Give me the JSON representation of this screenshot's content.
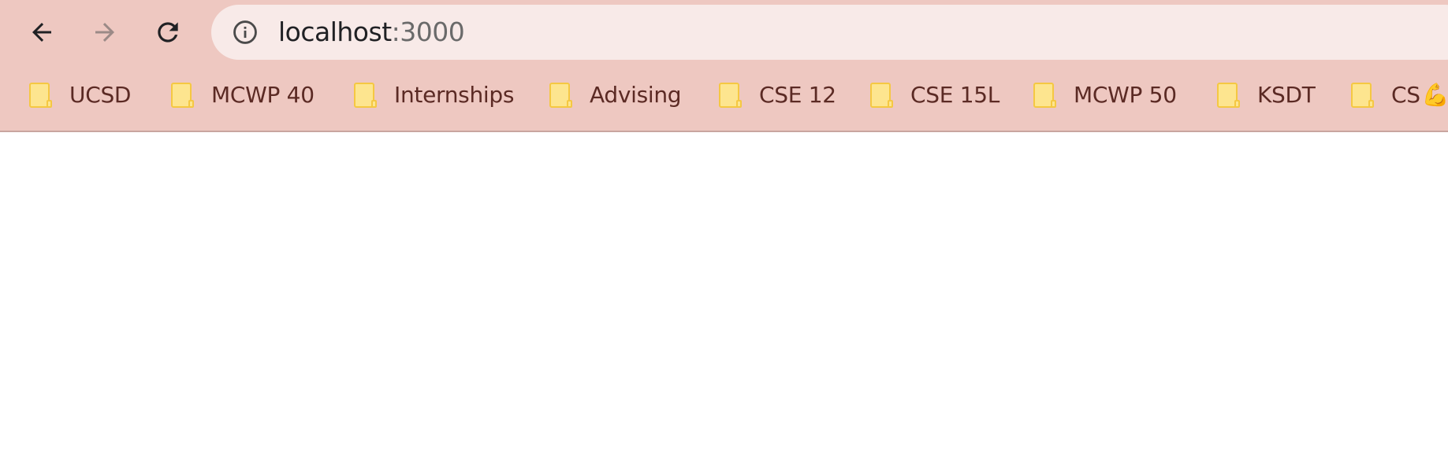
{
  "toolbar": {
    "back_icon": "arrow-left-icon",
    "forward_icon": "arrow-right-icon",
    "reload_icon": "reload-icon"
  },
  "omnibox": {
    "info_icon": "info-icon",
    "host": "localhost",
    "port": ":3000"
  },
  "bookmarks": [
    {
      "label": "UCSD",
      "icon": "folder-icon"
    },
    {
      "label": "MCWP 40",
      "icon": "folder-icon"
    },
    {
      "label": "Internships",
      "icon": "folder-icon"
    },
    {
      "label": "Advising",
      "icon": "folder-icon"
    },
    {
      "label": "CSE 12",
      "icon": "folder-icon"
    },
    {
      "label": "CSE 15L",
      "icon": "folder-icon"
    },
    {
      "label": "MCWP 50",
      "icon": "folder-icon"
    },
    {
      "label": "KSDT",
      "icon": "folder-icon"
    },
    {
      "label": "CS",
      "icon": "folder-icon",
      "emoji": "💪"
    }
  ],
  "colors": {
    "chrome_bg": "#eec8c1",
    "omnibox_bg": "#f8eae8",
    "folder_fill": "#fde58f",
    "folder_stroke": "#f5c842",
    "bookmark_text": "#5b2a24"
  }
}
